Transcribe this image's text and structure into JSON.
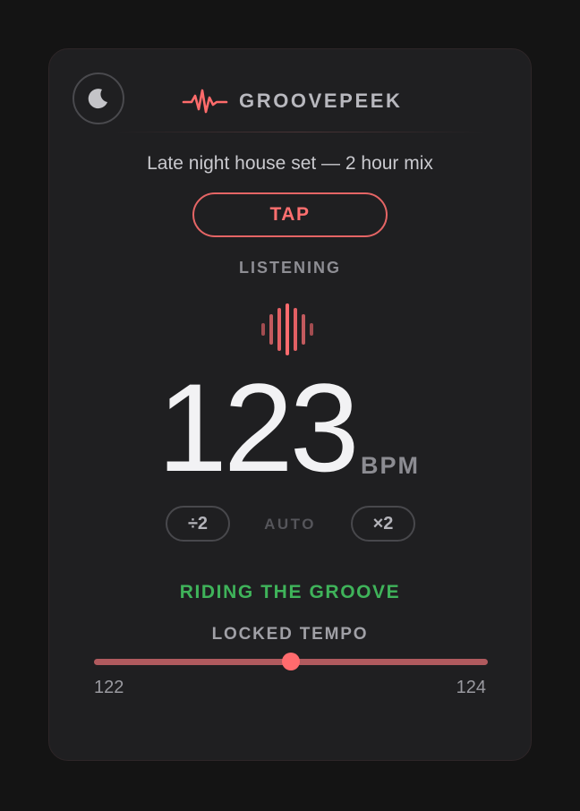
{
  "header": {
    "theme_icon": "moon-icon",
    "logo_icon": "waveform-pulse-icon",
    "app_name": "GROOVEPEEK"
  },
  "track": {
    "title": "Late night house set — 2 hour mix"
  },
  "controls": {
    "tap_label": "TAP",
    "status": "LISTENING",
    "half_label": "÷2",
    "double_label": "×2",
    "mode_label": "AUTO"
  },
  "tempo": {
    "bpm": "123",
    "unit": "BPM",
    "mood": "RIDING THE GROOVE",
    "lock_label": "LOCKED TEMPO",
    "range_min": "122",
    "range_max": "124",
    "slider_value": 123,
    "slider_min": 122,
    "slider_max": 124
  },
  "colors": {
    "accent": "#ff6f6f",
    "success": "#3fb35a",
    "background": "#141414",
    "card": "#1f1f21"
  }
}
